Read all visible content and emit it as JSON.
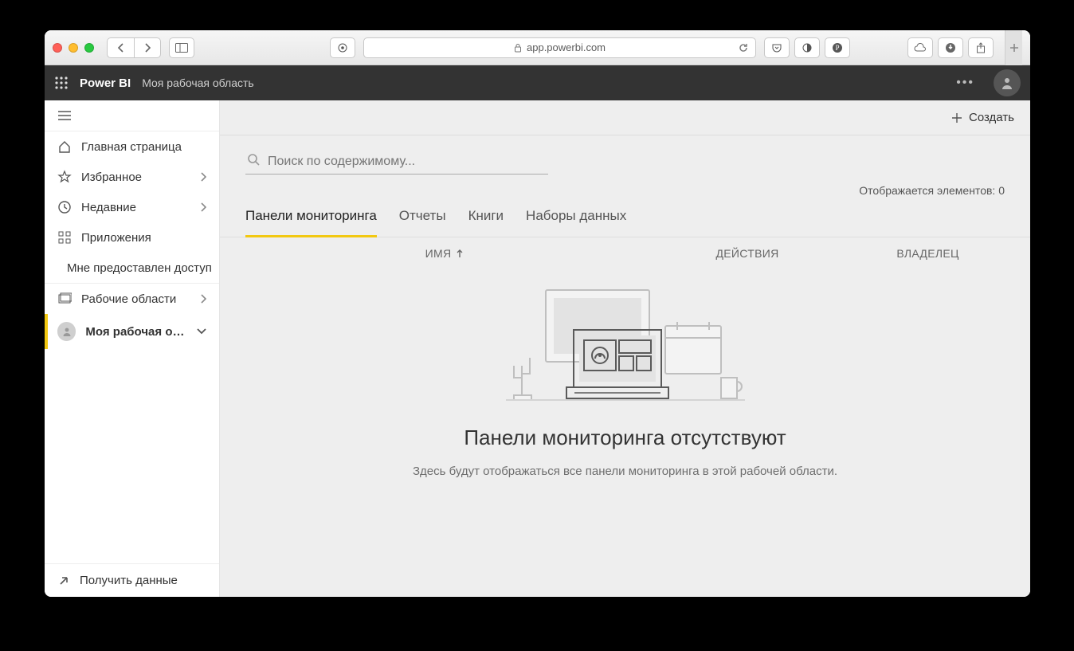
{
  "browser": {
    "url_display": "app.powerbi.com"
  },
  "header": {
    "app_name": "Power BI",
    "workspace_label": "Моя рабочая область"
  },
  "sidebar": {
    "items": [
      {
        "label": "Главная страница"
      },
      {
        "label": "Избранное"
      },
      {
        "label": "Недавние"
      },
      {
        "label": "Приложения"
      },
      {
        "label": "Мне предоставлен доступ"
      },
      {
        "label": "Рабочие области"
      },
      {
        "label": "Моя рабочая об..."
      }
    ],
    "get_data_label": "Получить данные"
  },
  "commands": {
    "create_label": "Создать"
  },
  "search": {
    "placeholder": "Поиск по содержимому..."
  },
  "counter": {
    "prefix": "Отображается элементов: ",
    "count": "0"
  },
  "tabs": [
    {
      "label": "Панели мониторинга",
      "active": true
    },
    {
      "label": "Отчеты"
    },
    {
      "label": "Книги"
    },
    {
      "label": "Наборы данных"
    }
  ],
  "columns": {
    "name": "ИМЯ",
    "actions": "ДЕЙСТВИЯ",
    "owner": "ВЛАДЕЛЕЦ"
  },
  "empty_state": {
    "title": "Панели мониторинга отсутствуют",
    "subtitle": "Здесь будут отображаться все панели мониторинга в этой рабочей области."
  }
}
